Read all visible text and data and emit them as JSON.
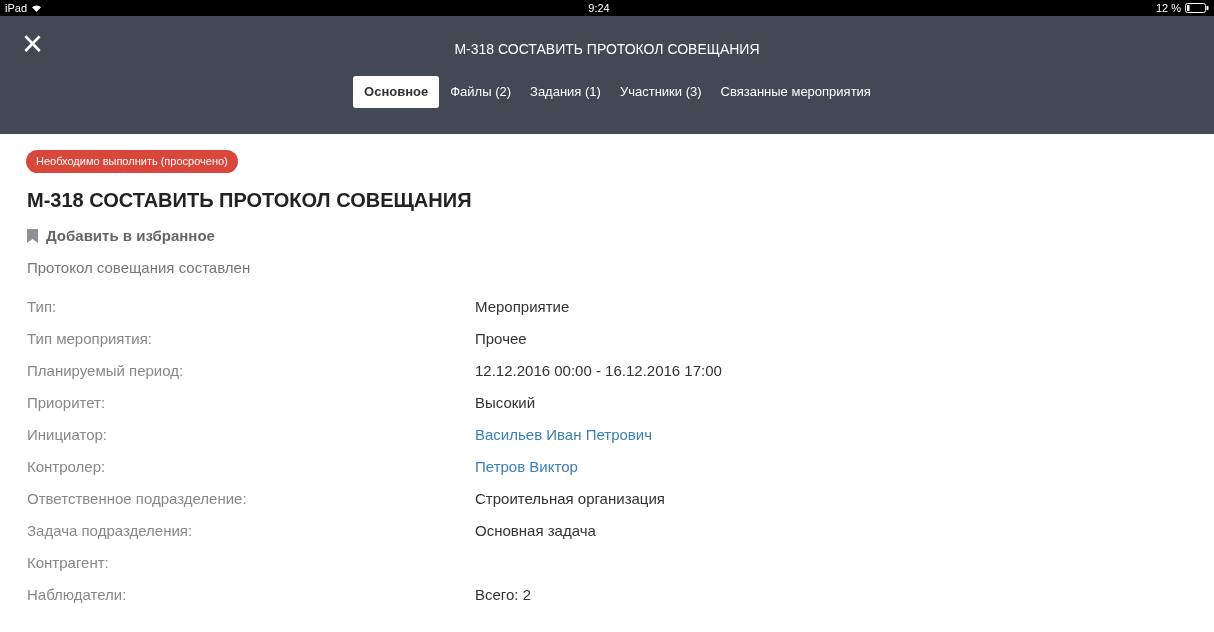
{
  "status_bar": {
    "device": "iPad",
    "time": "9:24",
    "battery": "12 %"
  },
  "header": {
    "close": "×",
    "title": "М-318 СОСТАВИТЬ ПРОТОКОЛ СОВЕЩАНИЯ"
  },
  "tabs": [
    {
      "label": "Основное",
      "selected": true
    },
    {
      "label": "Файлы (2)",
      "selected": false
    },
    {
      "label": "Задания (1)",
      "selected": false
    },
    {
      "label": "Участники (3)",
      "selected": false
    },
    {
      "label": "Связанные мероприятия",
      "selected": false
    }
  ],
  "status_badge": "Необходимо выполнить (просрочено)",
  "title": "М-318 СОСТАВИТЬ ПРОТОКОЛ СОВЕЩАНИЯ",
  "favorite": "Добавить в избранное",
  "description": "Протокол совещания составлен",
  "fields": [
    {
      "label": "Тип:",
      "value": "Мероприятие",
      "kind": "text"
    },
    {
      "label": "Тип мероприятия:",
      "value": "Прочее",
      "kind": "text"
    },
    {
      "label": "Планируемый период:",
      "value": "12.12.2016 00:00 - 16.12.2016 17:00",
      "kind": "text"
    },
    {
      "label": "Приоритет:",
      "value": "Высокий",
      "kind": "text"
    },
    {
      "label": "Инициатор:",
      "value": "Васильев Иван Петрович",
      "kind": "link"
    },
    {
      "label": "Контролер:",
      "value": "Петров Виктор",
      "kind": "link"
    },
    {
      "label": "Ответственное подразделение:",
      "value": "Строительная организация",
      "kind": "text"
    },
    {
      "label": "Задача подразделения:",
      "value": "Основная задача",
      "kind": "text"
    },
    {
      "label": "Контрагент:",
      "kind": "text"
    },
    {
      "label": "Наблюдатели:",
      "value": "Всего: 2",
      "kind": "text"
    }
  ]
}
